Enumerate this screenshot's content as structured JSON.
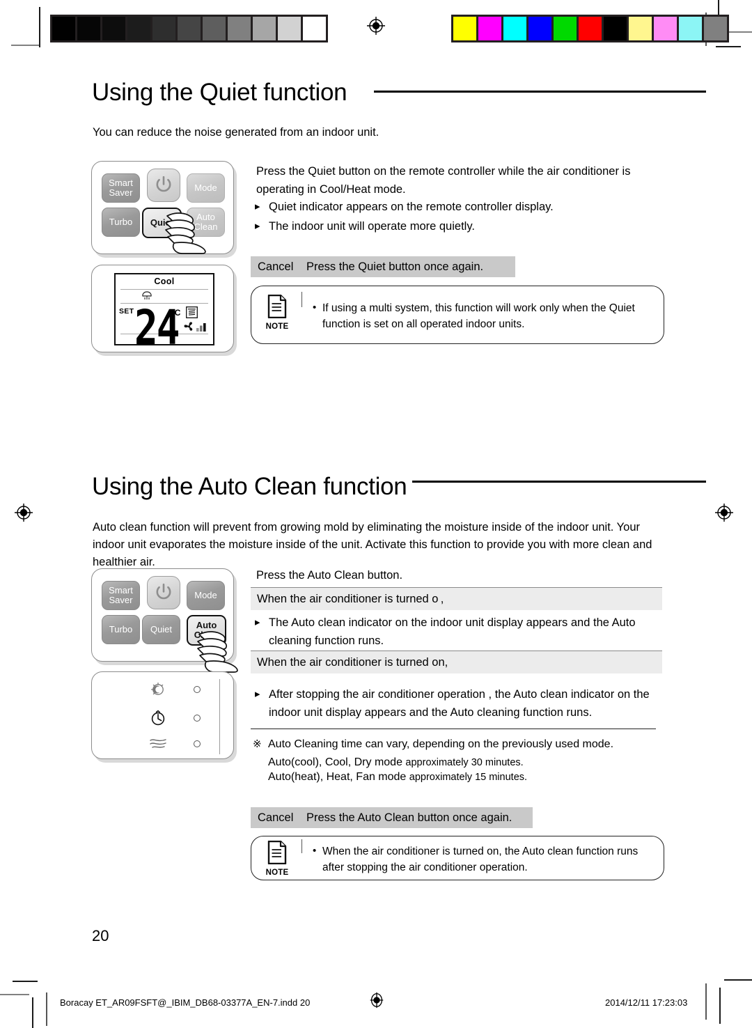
{
  "document": {
    "page_number": "20",
    "footer_left": "Boracay ET_AR09FSFT@_IBIM_DB68-03377A_EN-7.indd   20",
    "footer_right": "2014/12/11   17:23:03"
  },
  "print_marks": {
    "grayscale_bar": [
      "#010101",
      "#060606",
      "#0d0d0d",
      "#1c1c1c",
      "#2e2e2e",
      "#454545",
      "#5e5e5e",
      "#808080",
      "#a6a6a6",
      "#d2d2d2",
      "#ffffff"
    ],
    "color_bar": [
      "#ffff00",
      "#ff00ff",
      "#00ffff",
      "#0000ff",
      "#00d900",
      "#ff0000",
      "#000000",
      "#fff68f",
      "#ff8cf5",
      "#8cf5f5",
      "#808080"
    ],
    "registration_icon": "registration-target-icon"
  },
  "section1": {
    "title": "Using the Quiet function",
    "intro": "You can reduce the noise generated from an indoor unit.",
    "remote": {
      "buttons": [
        {
          "id": "smart-saver",
          "line1": "Smart",
          "line2": "Saver",
          "state": "normal"
        },
        {
          "id": "power",
          "label": "",
          "icon": "power-icon",
          "state": "light"
        },
        {
          "id": "mode",
          "line1": "Mode",
          "line2": "",
          "state": "light"
        },
        {
          "id": "turbo",
          "line1": "Turbo",
          "line2": "",
          "state": "normal"
        },
        {
          "id": "quiet",
          "line1": "Quiet",
          "line2": "",
          "state": "highlighted"
        },
        {
          "id": "auto-clean",
          "line1": "Auto",
          "line2": "Clean",
          "state": "light"
        }
      ],
      "pointing_hand": "hand-pointer-icon"
    },
    "lcd": {
      "mode_label": "Cool",
      "set_label": "SET",
      "temperature": "24",
      "unit": "°C",
      "icons": [
        "quiet-indicator-icon",
        "swing-icon",
        "fan-speed-icon"
      ]
    },
    "instruction": "Press the Quiet button on the remote controller while the air conditioner is operating in Cool/Heat mode.",
    "bullets": [
      "Quiet indicator appears on the remote controller display.",
      "The indoor unit will operate more quietly."
    ],
    "cancel": {
      "label": "Cancel",
      "text": "Press the Quiet button once again."
    },
    "note": {
      "icon_label": "NOTE",
      "text": "If using a multi system, this function will work only when the Quiet function is set on all operated indoor units."
    }
  },
  "section2": {
    "title": "Using the Auto Clean function",
    "intro": "Auto clean function will prevent from growing mold by eliminating the moisture inside of the indoor unit. Your indoor unit evaporates the moisture inside of the unit. Activate this function to provide you with more clean and healthier air.",
    "remote": {
      "buttons": [
        {
          "id": "smart-saver",
          "line1": "Smart",
          "line2": "Saver",
          "state": "normal"
        },
        {
          "id": "power",
          "label": "",
          "icon": "power-icon",
          "state": "light"
        },
        {
          "id": "mode",
          "line1": "Mode",
          "line2": "",
          "state": "normal"
        },
        {
          "id": "turbo",
          "line1": "Turbo",
          "line2": "",
          "state": "normal"
        },
        {
          "id": "quiet",
          "line1": "Quiet",
          "line2": "",
          "state": "normal"
        },
        {
          "id": "auto-clean",
          "line1": "Auto",
          "line2": "Clean",
          "state": "highlighted"
        }
      ],
      "pointing_hand": "hand-pointer-icon"
    },
    "indoor_panel": {
      "indicators": [
        {
          "icon": "good-sleep-icon",
          "led": "led-indicator"
        },
        {
          "icon": "timer-clock-icon",
          "led": "led-indicator"
        },
        {
          "icon": "auto-clean-wave-icon",
          "led": "led-indicator"
        }
      ]
    },
    "instruction": "Press the Auto Clean button.",
    "case_off": {
      "header": "When the air conditioner is turned o ,",
      "bullet": "The Auto clean indicator on the indoor unit display appears and the Auto cleaning function runs."
    },
    "case_on": {
      "header": "When the air conditioner is turned on,",
      "bullet": "After stopping the air conditioner operation , the Auto clean indicator on the indoor unit display appears and the Auto cleaning function runs."
    },
    "asterisk": {
      "text": "Auto Cleaning time can vary, depending on the previously used mode.",
      "line1_mode": "Auto(cool), Cool, Dry mode",
      "line1_time": "approximately 30 minutes.",
      "line2_mode": "Auto(heat), Heat, Fan mode",
      "line2_time": "approximately 15 minutes."
    },
    "cancel": {
      "label": "Cancel",
      "text": "Press the Auto Clean button once again."
    },
    "note": {
      "icon_label": "NOTE",
      "text": "When the air conditioner is turned on, the Auto clean function runs after stopping the air conditioner operation."
    }
  }
}
